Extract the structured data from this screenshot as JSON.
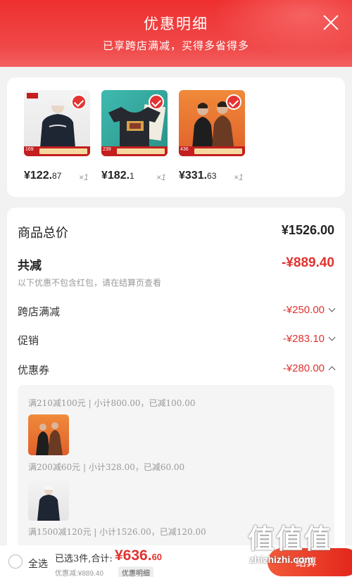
{
  "header": {
    "title": "优惠明细",
    "subtitle": "已享跨店满减，买得多省得多"
  },
  "colors": {
    "brand_red": "#ee2f2f",
    "discount_red": "#e0332f"
  },
  "products": [
    {
      "price_main": "¥122.",
      "price_cents": "87",
      "qty": "×1",
      "thumb_tag": "169",
      "icon": "sweatshirt-image"
    },
    {
      "price_main": "¥182.",
      "price_cents": "1",
      "qty": "×1",
      "thumb_tag": "239",
      "icon": "tshirt-image"
    },
    {
      "price_main": "¥331.",
      "price_cents": "63",
      "qty": "×1",
      "thumb_tag": "436",
      "icon": "couple-jackets-image"
    }
  ],
  "summary": {
    "total_label": "商品总价",
    "total_value": "¥1526.00",
    "reduce_label": "共减",
    "reduce_value": "-¥889.40",
    "hint": "以下优惠不包含红包，请在结算页查看",
    "cross_store_label": "跨店满减",
    "cross_store_value": "-¥250.00",
    "promo_label": "促销",
    "promo_value": "-¥283.10",
    "coupon_label": "优惠券",
    "coupon_value": "-¥280.00"
  },
  "coupons": [
    {
      "text": "满210减100元 | 小计800.00，已减100.00"
    },
    {
      "text": "满200减60元 | 小计328.00，已减60.00"
    },
    {
      "text": "满1500减120元 | 小计1526.00，已减120.00"
    }
  ],
  "bottom": {
    "select_all": "全选",
    "selected_info": "已选3件,合计:",
    "total_main": "¥636.",
    "total_cents": "60",
    "discount_text": "优惠减:¥889.40",
    "detail_chip": "优惠明细",
    "checkout": "结算"
  },
  "watermark": {
    "big": "值值值",
    "small": "zhizhizhi.com"
  }
}
